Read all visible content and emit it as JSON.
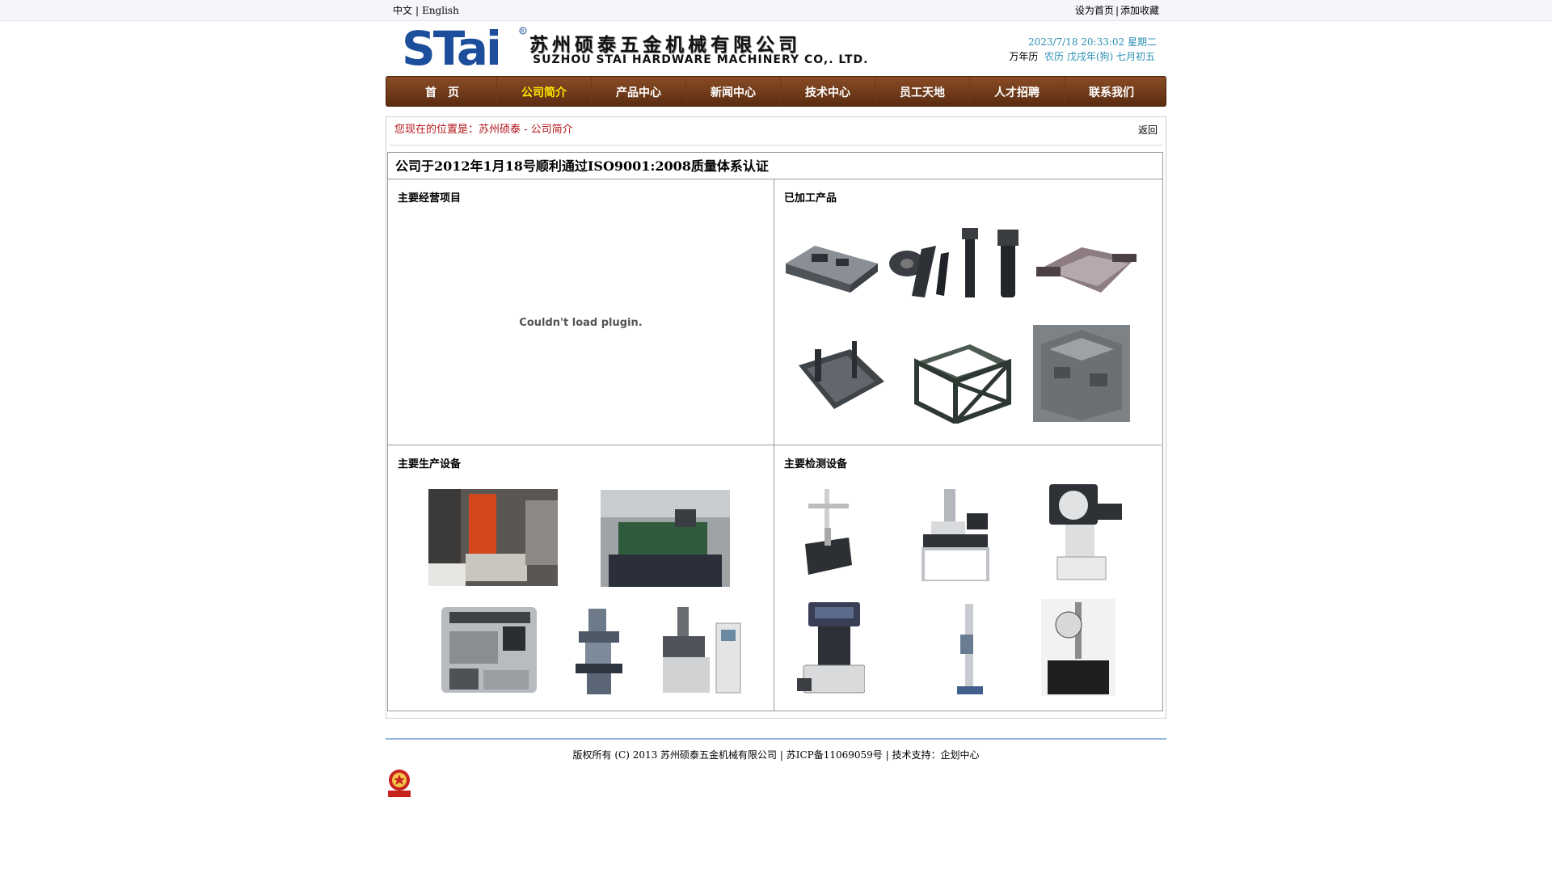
{
  "topbar": {
    "lang_cn": "中文",
    "lang_sep": "|",
    "lang_en": "English",
    "set_home": "设为首页",
    "fav_sep": "|",
    "add_fav": "添加收藏"
  },
  "header": {
    "logo_text": "STai",
    "company_cn": "苏州硕泰五金机械有限公司",
    "company_en": "SUZHOU STAI HARDWARE MACHINERY CO,. LTD.",
    "datetime": "2023/7/18 20:33:02 星期二",
    "calendar_label": "万年历",
    "calendar_value": "农历 戊戌年(狗) 七月初五"
  },
  "nav": {
    "items": [
      "首　页",
      "公司简介",
      "产品中心",
      "新闻中心",
      "技术中心",
      "员工天地",
      "人才招聘",
      "联系我们"
    ],
    "active_index": 1
  },
  "breadcrumb": {
    "text": "您现在的位置是：苏州硕泰 - 公司简介",
    "back": "返回"
  },
  "content": {
    "title": "公司于2012年1月18号顺利通过ISO9001:2008质量体系认证",
    "sections": {
      "business": "主要经营项目",
      "products": "已加工产品",
      "production": "主要生产设备",
      "inspection": "主要检测设备"
    },
    "plugin_error": "Couldn't load plugin."
  },
  "footer": {
    "copyright": "版权所有 (C) 2013 苏州硕泰五金机械有限公司 | 苏ICP备11069059号 | 技术支持：企划中心"
  },
  "colors": {
    "nav_bg": "#6e3817",
    "nav_active": "#ffe600",
    "breadcrumb": "#b3141a",
    "date": "#2a8fb3",
    "footer_line": "#8db4de"
  }
}
